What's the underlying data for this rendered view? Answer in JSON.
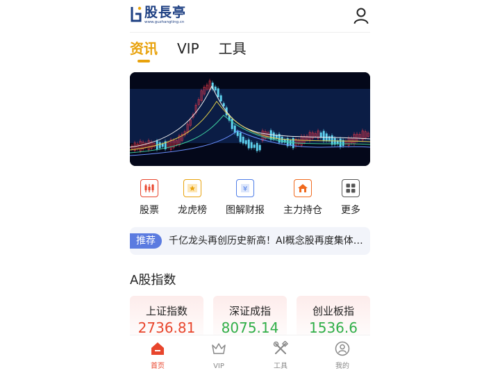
{
  "header": {
    "logo_name": "股長亭",
    "logo_url": "www.guzhangting.cn"
  },
  "tabs": [
    {
      "label": "资讯",
      "active": true
    },
    {
      "label": "VIP",
      "active": false
    },
    {
      "label": "工具",
      "active": false
    }
  ],
  "quicknav": [
    {
      "label": "股票",
      "icon": "candlestick-icon",
      "color": "#e8452c"
    },
    {
      "label": "龙虎榜",
      "icon": "star-badge-icon",
      "color": "#e8a20c"
    },
    {
      "label": "图解财报",
      "icon": "report-yen-icon",
      "color": "#4f7ee8"
    },
    {
      "label": "主力持仓",
      "icon": "house-icon",
      "color": "#f06a1e"
    },
    {
      "label": "更多",
      "icon": "grid-icon",
      "color": "#555555"
    }
  ],
  "recommend": {
    "badge": "推荐",
    "text": "千亿龙头再创历史新高！AI概念股再度集体爆发"
  },
  "section": {
    "title": "A股指数"
  },
  "indices": [
    {
      "name": "上证指数",
      "value": "2736.81",
      "color": "#e8452c"
    },
    {
      "name": "深证成指",
      "value": "8075.14",
      "color": "#2fae47"
    },
    {
      "name": "创业板指",
      "value": "1536.6",
      "color": "#2fae47"
    }
  ],
  "bottomnav": [
    {
      "label": "首页",
      "icon": "home-icon",
      "active": true
    },
    {
      "label": "VIP",
      "icon": "crown-icon",
      "active": false
    },
    {
      "label": "工具",
      "icon": "tools-icon",
      "active": false
    },
    {
      "label": "我的",
      "icon": "profile-icon",
      "active": false
    }
  ],
  "colors": {
    "accent": "#e8a20c",
    "up": "#e8452c",
    "down": "#2fae47",
    "badge": "#5b7be0"
  }
}
